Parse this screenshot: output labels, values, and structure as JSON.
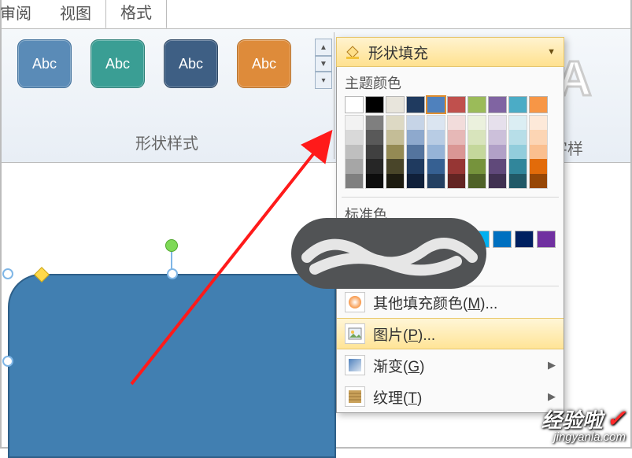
{
  "tabs": {
    "review": "审阅",
    "view": "视图",
    "format": "格式"
  },
  "ribbon": {
    "shape_styles_label": "形状样式",
    "wordart_label": "艺术字样",
    "abc": "Abc",
    "fill_button_label": "形状填充"
  },
  "dropdown": {
    "theme_label": "主题颜色",
    "standard_label": "标准色",
    "more_colors": "其他填充颜色(",
    "more_colors_key": "M",
    "more_colors_tail": ")...",
    "picture": "图片(",
    "picture_key": "P",
    "picture_tail": ")...",
    "gradient": "渐变(",
    "gradient_key": "G",
    "gradient_tail": ")",
    "texture": "纹理(",
    "texture_key": "T",
    "texture_tail": ")",
    "theme_row": [
      "#ffffff",
      "#000000",
      "#e8e5dc",
      "#1f3a5f",
      "#4f81bd",
      "#c0504d",
      "#9bbb59",
      "#8064a2",
      "#4bacc6",
      "#f79646"
    ],
    "theme_cols": [
      [
        "#f2f2f2",
        "#d9d9d9",
        "#bfbfbf",
        "#a6a6a6",
        "#808080"
      ],
      [
        "#7f7f7f",
        "#595959",
        "#404040",
        "#262626",
        "#0d0d0d"
      ],
      [
        "#ddd9c4",
        "#c4bd97",
        "#948a54",
        "#494529",
        "#1d1b10"
      ],
      [
        "#c6d4e7",
        "#8ea9cd",
        "#54749e",
        "#1f3a5f",
        "#10203a"
      ],
      [
        "#dbe5f1",
        "#b8cce4",
        "#95b3d7",
        "#366092",
        "#244062"
      ],
      [
        "#f2dcdb",
        "#e6b8b7",
        "#da9694",
        "#963634",
        "#632523"
      ],
      [
        "#ebf1dd",
        "#d8e4bc",
        "#c4d79b",
        "#76933c",
        "#4f6228"
      ],
      [
        "#e6e0ec",
        "#ccc0da",
        "#b1a0c7",
        "#60497a",
        "#403151"
      ],
      [
        "#dbeef3",
        "#b7dee8",
        "#92cddc",
        "#31869b",
        "#215967"
      ],
      [
        "#fde9d9",
        "#fcd5b4",
        "#fabf8f",
        "#e26b0a",
        "#974706"
      ]
    ],
    "standard_row": [
      "#c00000",
      "#ff0000",
      "#ffc000",
      "#ffff00",
      "#92d050",
      "#00b050",
      "#00b0f0",
      "#0070c0",
      "#002060",
      "#7030a0"
    ]
  },
  "watermark": {
    "brand": "经验啦",
    "url": "jingyanla.com"
  }
}
